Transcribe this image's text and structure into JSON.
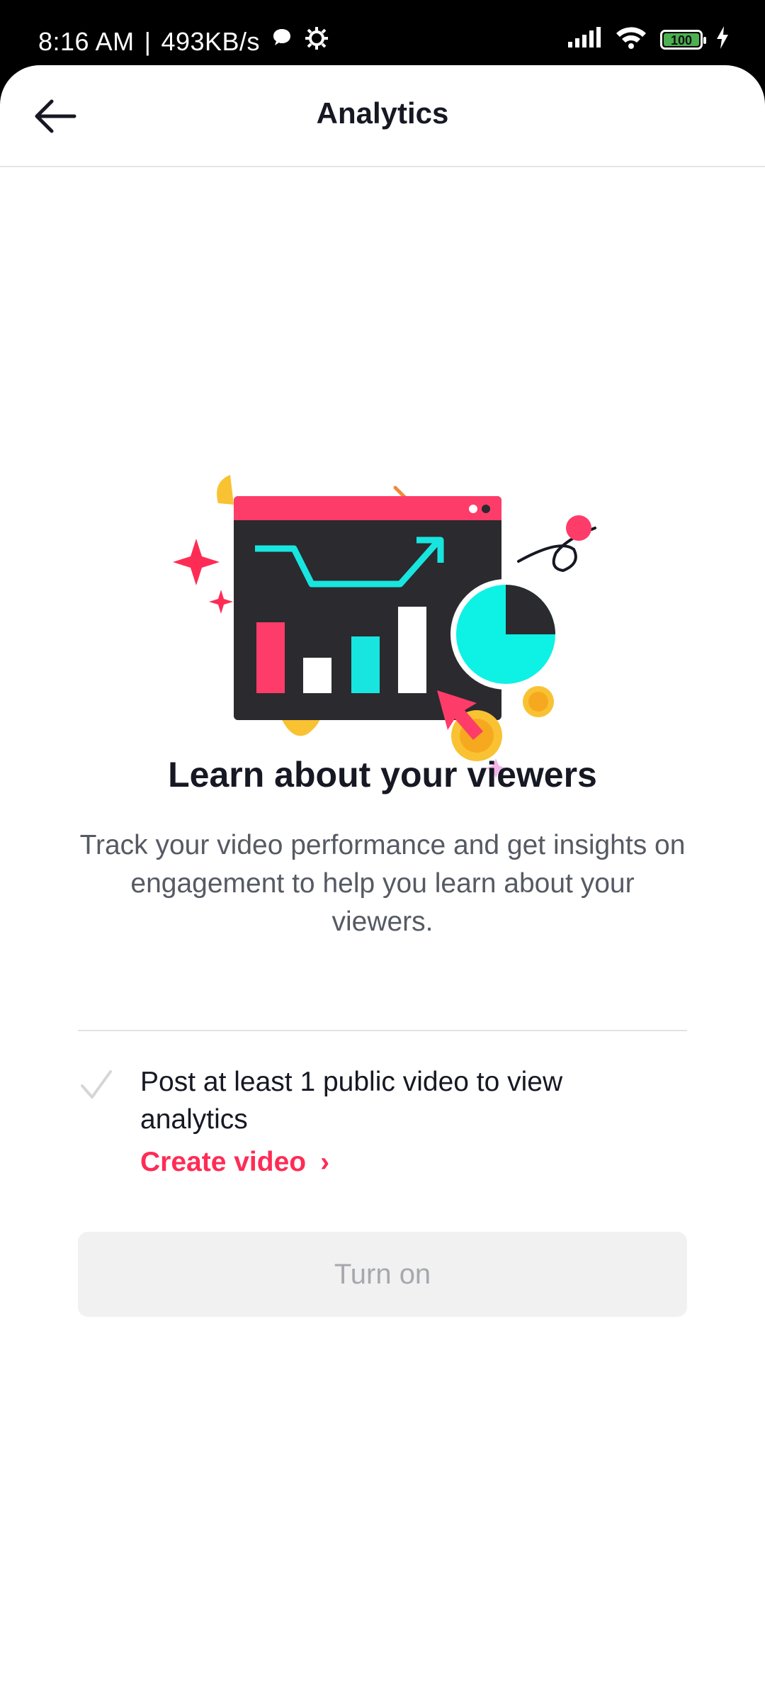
{
  "status_bar": {
    "time": "8:16 AM",
    "separator": "|",
    "speed": "493KB/s",
    "battery": "100"
  },
  "nav": {
    "title": "Analytics"
  },
  "content": {
    "heading": "Learn about your viewers",
    "description": "Track your video performance and get insights on engagement to help you learn about your viewers.",
    "requirement": "Post at least 1 public video to view analytics",
    "create_link": "Create video",
    "create_link_chevron": "›",
    "turn_on_label": "Turn on"
  },
  "colors": {
    "accent": "#fe2c55",
    "cyan": "#0ef1e5",
    "dark": "#2b2a2e",
    "yellow": "#f9c233"
  }
}
